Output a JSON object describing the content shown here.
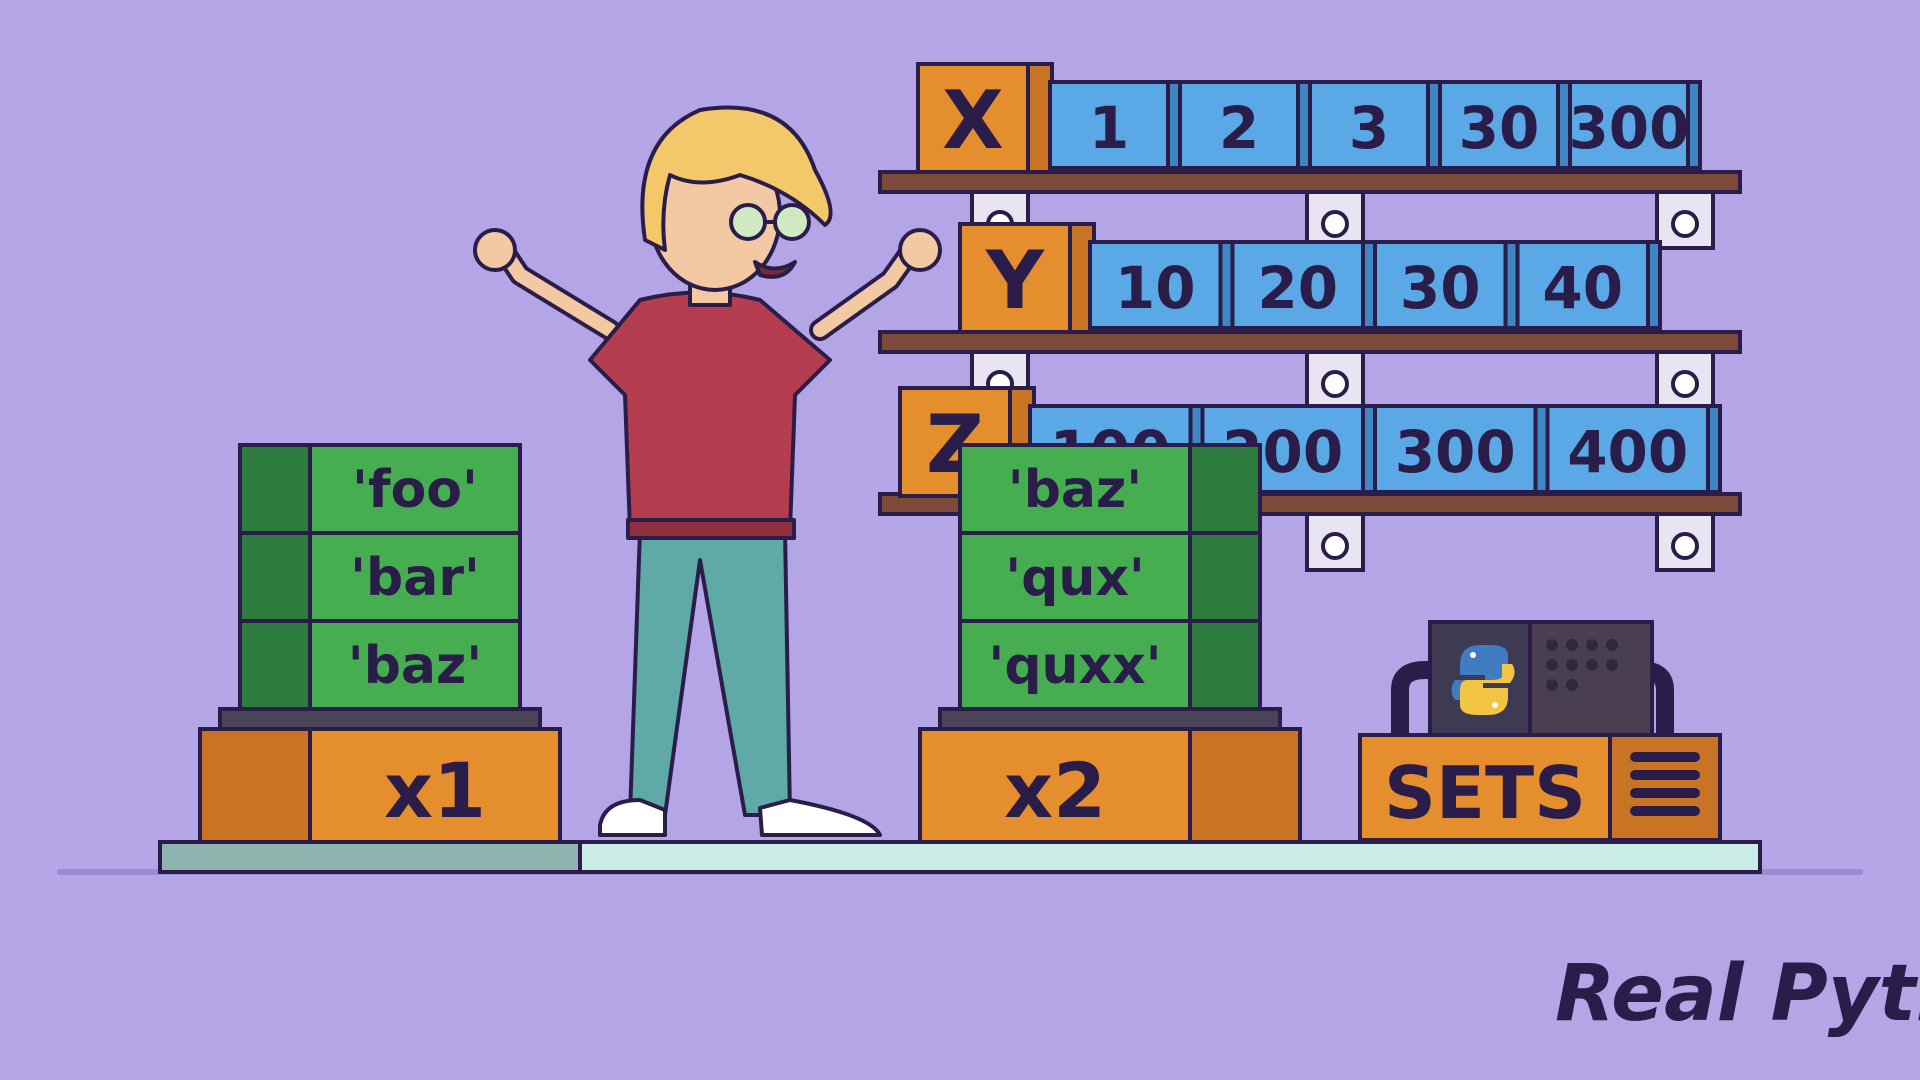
{
  "shelves": [
    {
      "label": "X",
      "values": [
        "1",
        "2",
        "3",
        "30",
        "300"
      ]
    },
    {
      "label": "Y",
      "values": [
        "10",
        "20",
        "30",
        "40"
      ]
    },
    {
      "label": "Z",
      "values": [
        "100",
        "200",
        "300",
        "400"
      ]
    }
  ],
  "stacks": [
    {
      "label": "x1",
      "items": [
        "'foo'",
        "'bar'",
        "'baz'"
      ]
    },
    {
      "label": "x2",
      "items": [
        "'baz'",
        "'qux'",
        "'quxx'"
      ]
    }
  ],
  "machine": {
    "label": "SETS",
    "icon": "python-logo-icon"
  },
  "brand": {
    "name": "Real Python"
  },
  "colors": {
    "background": "#b3a5e6",
    "blue_box": "#5aa9e6",
    "green_box": "#46ad50",
    "orange_box": "#e58e2e",
    "shelf": "#7d4a3a",
    "outline": "#2b1d4a"
  }
}
